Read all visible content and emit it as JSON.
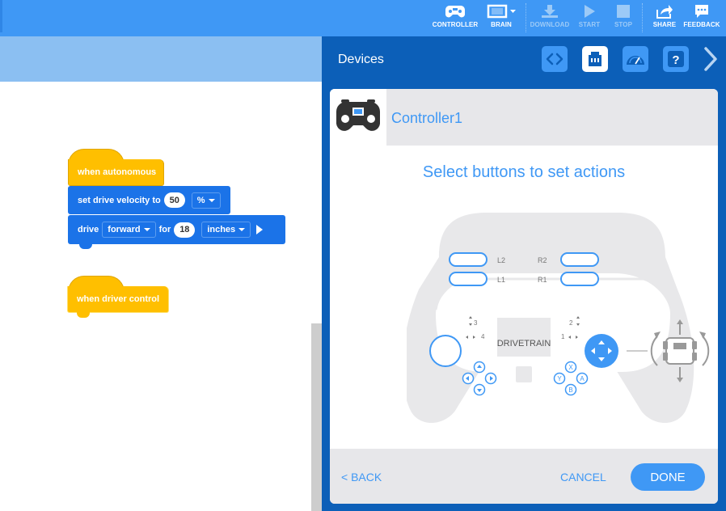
{
  "toolbar": {
    "controller_label": "CONTROLLER",
    "brain_label": "BRAIN",
    "download_label": "DOWNLOAD",
    "start_label": "START",
    "stop_label": "STOP",
    "share_label": "SHARE",
    "feedback_label": "FEEDBACK"
  },
  "workspace": {
    "when_autonomous": "when autonomous",
    "set_velocity": {
      "label": "set drive velocity to",
      "value": "50",
      "unit": "%"
    },
    "drive": {
      "label": "drive",
      "direction": "forward",
      "for_label": "for",
      "distance": "18",
      "unit": "inches"
    },
    "when_driver_control": "when driver control"
  },
  "panel": {
    "title": "Devices",
    "device_name": "Controller1",
    "instruction": "Select buttons to set actions",
    "labels": {
      "l2": "L2",
      "l1": "L1",
      "r2": "R2",
      "r1": "R1",
      "axis3": "3",
      "axis4": "4",
      "axis2": "2",
      "axis1": "1",
      "screen": "DRIVETRAIN",
      "x": "X",
      "y": "Y",
      "a": "A",
      "b": "B"
    },
    "back_label": "< BACK",
    "cancel_label": "CANCEL",
    "done_label": "DONE"
  },
  "colors": {
    "accent": "#3f98f5",
    "panel_bg": "#0c5fb8",
    "event_block": "#ffbf00",
    "motion_block": "#1b73e8"
  }
}
